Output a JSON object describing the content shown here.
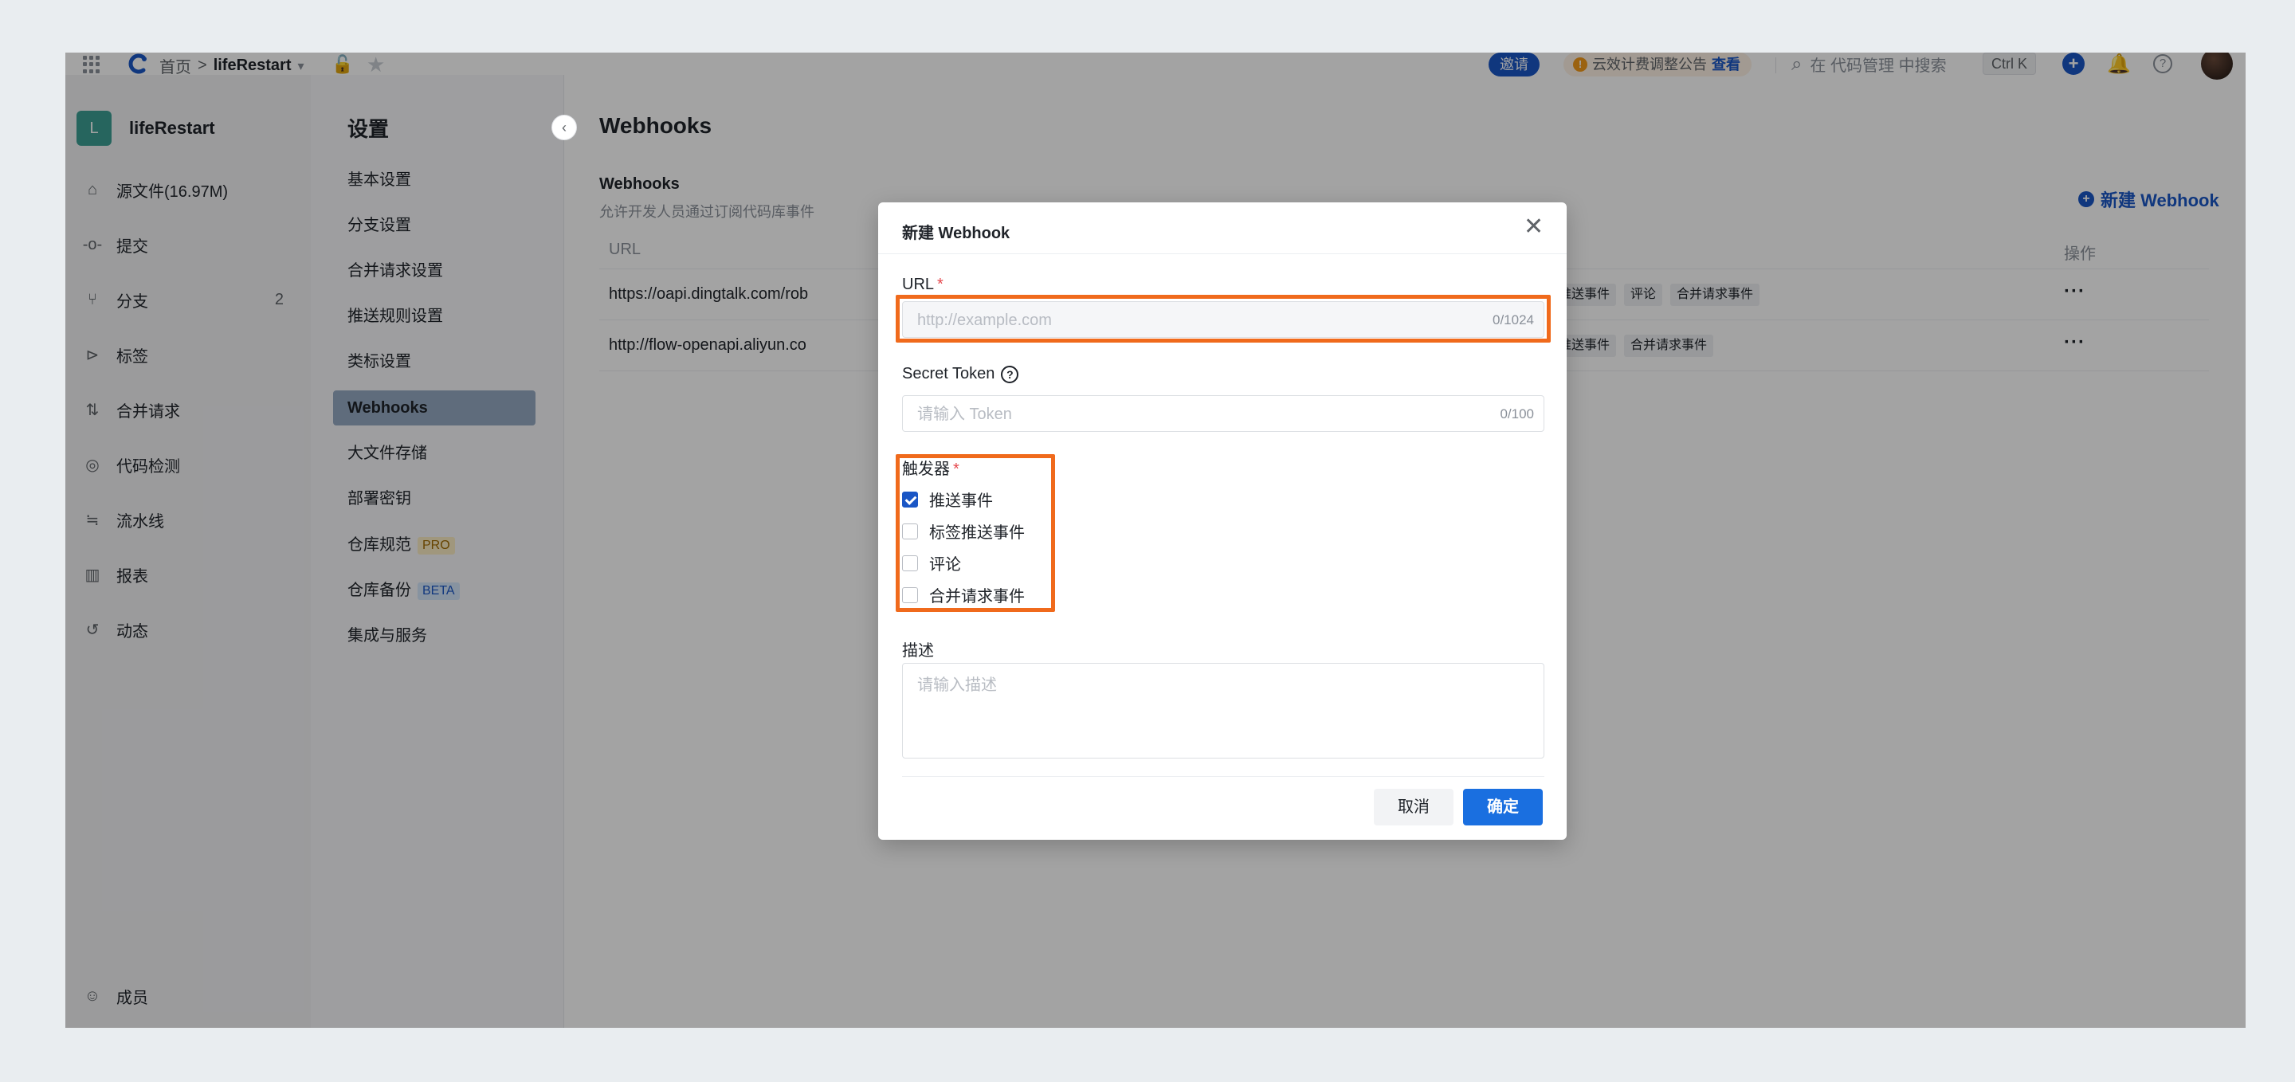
{
  "topbar": {
    "home": "首页",
    "separator": ">",
    "repo": "lifeRestart",
    "repo_caret": "▾",
    "lock_icon": "🔓",
    "star_icon": "★",
    "invite": "邀请",
    "notice_icon": "!",
    "notice": "云效计费调整公告",
    "notice_link": "查看",
    "search_icon": "⌕",
    "search_placeholder": "在 代码管理 中搜索",
    "shortcut": "Ctrl K",
    "plus_icon": "+",
    "bell_icon": "🔔",
    "help_icon": "?"
  },
  "sidebar": {
    "avatar_letter": "L",
    "repo_name": "lifeRestart",
    "items": [
      {
        "icon": "⌂",
        "label": "源文件(16.97M)",
        "count": ""
      },
      {
        "icon": "-o-",
        "label": "提交",
        "count": ""
      },
      {
        "icon": "⑂",
        "label": "分支",
        "count": "2"
      },
      {
        "icon": "⊳",
        "label": "标签",
        "count": ""
      },
      {
        "icon": "⇅",
        "label": "合并请求",
        "count": ""
      },
      {
        "icon": "◎",
        "label": "代码检测",
        "count": ""
      },
      {
        "icon": "≒",
        "label": "流水线",
        "count": ""
      },
      {
        "icon": "▥",
        "label": "报表",
        "count": ""
      },
      {
        "icon": "↺",
        "label": "动态",
        "count": ""
      }
    ],
    "members": {
      "icon": "☺",
      "label": "成员"
    }
  },
  "settings_menu": {
    "title": "设置",
    "collapse_icon": "‹",
    "items": [
      {
        "label": "基本设置",
        "tag": ""
      },
      {
        "label": "分支设置",
        "tag": ""
      },
      {
        "label": "合并请求设置",
        "tag": ""
      },
      {
        "label": "推送规则设置",
        "tag": ""
      },
      {
        "label": "类标设置",
        "tag": ""
      },
      {
        "label": "Webhooks",
        "tag": ""
      },
      {
        "label": "大文件存储",
        "tag": ""
      },
      {
        "label": "部署密钥",
        "tag": ""
      },
      {
        "label": "仓库规范",
        "tag": "PRO"
      },
      {
        "label": "仓库备份",
        "tag": "BETA"
      },
      {
        "label": "集成与服务",
        "tag": ""
      }
    ],
    "active_index": 5
  },
  "main": {
    "title": "Webhooks",
    "section_title": "Webhooks",
    "section_desc": "允许开发人员通过订阅代码库事件",
    "new_button": "新建 Webhook",
    "table": {
      "col_url": "URL",
      "col_actions": "操作",
      "rows": [
        {
          "url": "https://oapi.dingtalk.com/rob",
          "tags": [
            "标签推送事件",
            "评论",
            "合并请求事件"
          ],
          "more": "···"
        },
        {
          "url": "http://flow-openapi.aliyun.co",
          "tags": [
            "标签推送事件",
            "合并请求事件"
          ],
          "more": "···"
        }
      ]
    }
  },
  "modal": {
    "title": "新建 Webhook",
    "close_icon": "✕",
    "url_label": "URL",
    "required_mark": "*",
    "url_placeholder": "http://example.com",
    "url_value": "",
    "url_count": "0/1024",
    "token_label": "Secret Token",
    "token_help": "?",
    "token_placeholder": "请输入 Token",
    "token_value": "",
    "token_count": "0/100",
    "trigger_label": "触发器",
    "triggers": [
      {
        "label": "推送事件",
        "checked": true
      },
      {
        "label": "标签推送事件",
        "checked": false
      },
      {
        "label": "评论",
        "checked": false
      },
      {
        "label": "合并请求事件",
        "checked": false
      }
    ],
    "desc_label": "描述",
    "desc_placeholder": "请输入描述",
    "desc_value": "",
    "cancel": "取消",
    "confirm": "确定"
  },
  "colors": {
    "accent": "#1a56c5",
    "highlight": "#f06a1c",
    "active_menu": "#95a9c3",
    "repo_avatar": "#3c9e94"
  }
}
